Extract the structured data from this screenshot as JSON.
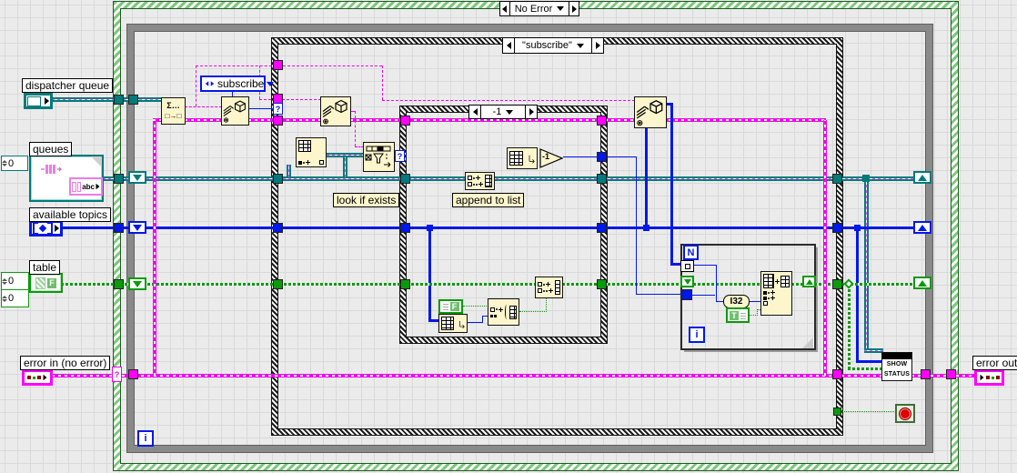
{
  "selectors": {
    "outer": "No Error",
    "inner": "\"subscribe\"",
    "not_found_case": "-1"
  },
  "controls": {
    "dispatcher_queue_label": "dispatcher queue",
    "queues_label": "queues",
    "queues_index": "0",
    "queues_element_text": "abc",
    "available_topics_label": "available topics",
    "table_label": "table",
    "table_index_row": "0",
    "table_index_col": "0",
    "error_in_label": "error in (no error)",
    "error_out_label": "error out"
  },
  "constants": {
    "enum_value": "subscribe",
    "true_const": "T",
    "false_const": "F",
    "i32_conversion": "I32",
    "decrement": "-1"
  },
  "loops": {
    "while_iteration": "i",
    "for_count": "N",
    "for_iteration": "i"
  },
  "annotations": {
    "look_if_exists": "look if exists",
    "append_to_list": "append to list"
  },
  "nodes": {
    "dequeue_glyph_top": "Σ…",
    "dequeue_glyph_bottom": "□→□",
    "show_status_line1": "SHOW",
    "show_status_line2": "STATUS",
    "selector_glyph": "?"
  },
  "colors": {
    "queue_wire": "#007a7a",
    "topics_wire": "#0018e8",
    "table_wire": "#0b9a0b",
    "error_wire": "#ff00ff",
    "case_border_green": "#7cc87c",
    "while_border_gray": "#8a8a8a",
    "node_background": "#fdf6cd",
    "stop_button_red": "#e00000"
  }
}
